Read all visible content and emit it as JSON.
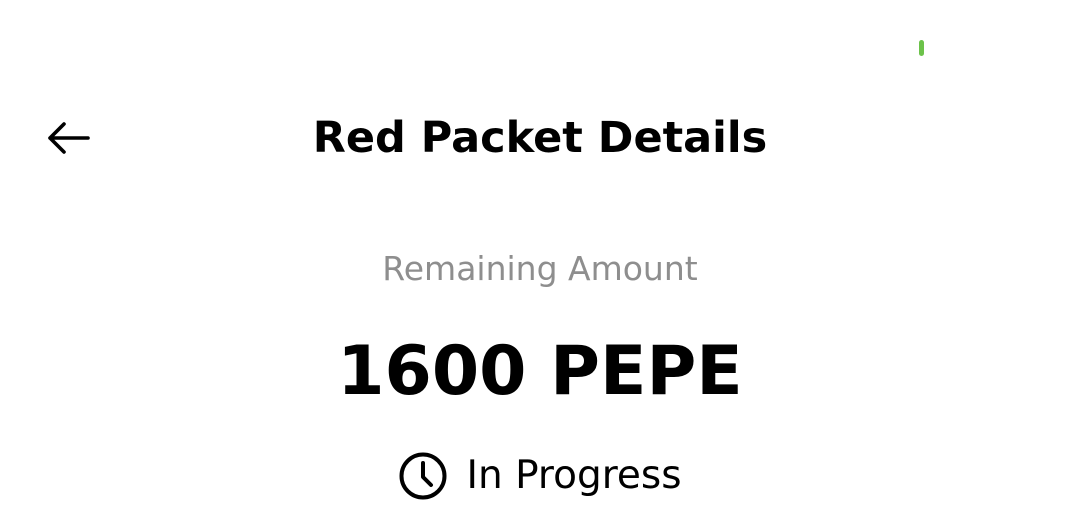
{
  "header": {
    "back_icon": "arrow-left-icon",
    "title": "Red Packet Details"
  },
  "summary": {
    "remaining_label": "Remaining Amount",
    "amount": "1600 PEPE",
    "status_icon": "clock-icon",
    "status": "In Progress"
  },
  "colors": {
    "text": "#000000",
    "muted_text": "#8e8e8e",
    "status_indicator": "#6cc24a",
    "background": "#ffffff"
  }
}
